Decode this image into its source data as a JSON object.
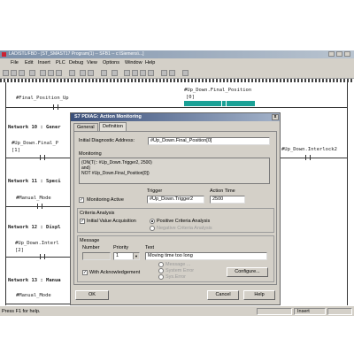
{
  "window": {
    "title": "LAD/STL/FBD - [ST_SMAST17 Program(1) -- SFB1 -- c:\\Siemens\\...]",
    "menu": [
      "File",
      "Edit",
      "Insert",
      "PLC",
      "Debug",
      "View",
      "Options",
      "Window",
      "Help"
    ]
  },
  "editor": {
    "contact_top_left": "#Final_Position_Up",
    "contact_top_right": "#Up_Down.Final_Position",
    "contact_top_right_index": "[0]",
    "net10": "Network 10 : Gener",
    "net10_contact": "#Up_Down.Final_P",
    "net10_index": "[1]",
    "net10_right": "#Up_Down.Interlock2",
    "net11": "Network 11 : Speci",
    "net11_contact": "#Manual_Mode",
    "net12": "Network 12 : Displ",
    "net12_contact": "#Up_Down.Interl",
    "net12_index": "[2]",
    "net13": "Network 13 : Manua",
    "net13_contact": "#Manual_Mode"
  },
  "status": {
    "help": "Press F1 for help.",
    "mode": "Insert"
  },
  "dialog": {
    "title": "S7 PDIAG: Action Monitoring",
    "close_label": "x",
    "tabs": [
      "General",
      "Definition"
    ],
    "initial_address_label": "Initial Diagnostic Address:",
    "initial_address_value": "#Up_Down.Final_Position[0]",
    "monitoring_label": "Monitoring",
    "monitoring_text": "(ON(T(:: #Up_Down.Trigger2, 2500)\nand)\nNOT #Up_Down.Final_Position[0])",
    "monitoring_active_label": "Monitoring Active",
    "trigger_label": "Trigger",
    "trigger_value": "#Up_Down.Trigger2",
    "action_time_label": "Action Time",
    "action_time_value": "2500",
    "criteria_label": "Criteria Analysis",
    "initial_value_acq": "Initial Value Acquisition",
    "positive_criteria": "Positive Criteria Analysis",
    "negative_criteria": "Negative Criteria Analysis",
    "message_label": "Message",
    "number_label": "Number",
    "priority_label": "Priority",
    "text_label": "Text",
    "priority_value": "1",
    "message_text": "Moving time too long",
    "acknowledgement_label": "With Acknowledgement",
    "mode_options": [
      "Message ...",
      "System Error",
      "Sys.Error"
    ],
    "configure_label": "Configure...",
    "ok_label": "OK",
    "cancel_label": "Cancel",
    "help_label": "Help"
  }
}
